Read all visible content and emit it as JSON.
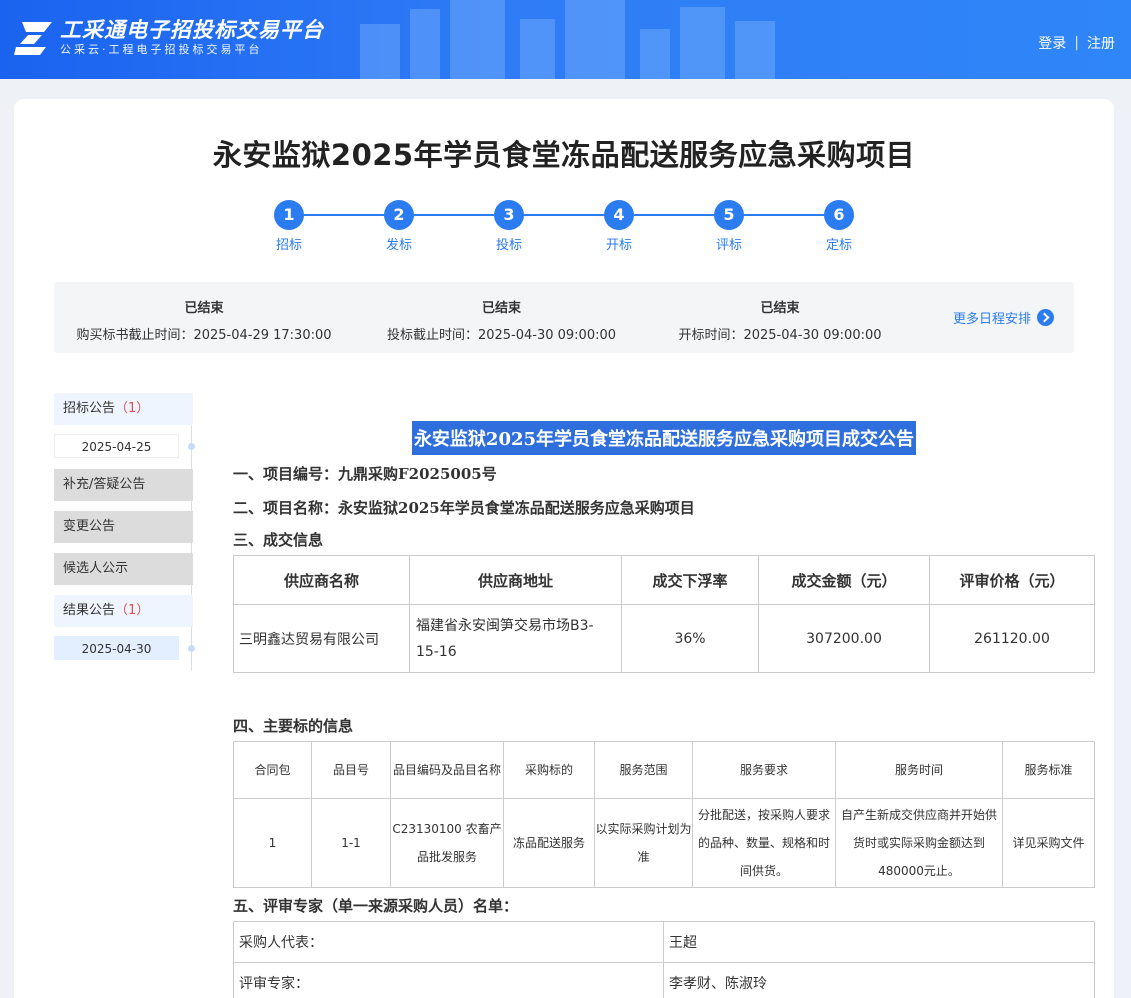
{
  "header": {
    "logo_title": "工采通电子招投标交易平台",
    "logo_sub": "公采云·工程电子招投标交易平台",
    "login": "登录",
    "separator": "|",
    "register": "注册"
  },
  "project": {
    "title": "永安监狱2025年学员食堂冻品配送服务应急采购项目"
  },
  "steps": [
    {
      "num": "1",
      "label": "招标"
    },
    {
      "num": "2",
      "label": "发标"
    },
    {
      "num": "3",
      "label": "投标"
    },
    {
      "num": "4",
      "label": "开标"
    },
    {
      "num": "5",
      "label": "评标"
    },
    {
      "num": "6",
      "label": "定标"
    }
  ],
  "schedule": {
    "items": [
      {
        "status": "已结束",
        "text": "购买标书截止时间：2025-04-29 17:30:00"
      },
      {
        "status": "已结束",
        "text": "投标截止时间：2025-04-30 09:00:00"
      },
      {
        "status": "已结束",
        "text": "开标时间：2025-04-30 09:00:00"
      }
    ],
    "more": "更多日程安排"
  },
  "sidebar": {
    "bid_notice": "招标公告",
    "bid_notice_count": "（1）",
    "bid_notice_date": "2025-04-25",
    "supplement": "补充/答疑公告",
    "change": "变更公告",
    "candidate": "候选人公示",
    "result": "结果公告",
    "result_count": "（1）",
    "result_date": "2025-04-30"
  },
  "doc": {
    "title": "永安监狱2025年学员食堂冻品配送服务应急采购项目成交公告",
    "s1": "一、项目编号：九鼎采购F2025005号",
    "s2": "二、项目名称：永安监狱2025年学员食堂冻品配送服务应急采购项目",
    "s3": "三、成交信息",
    "t1_headers": [
      "供应商名称",
      "供应商地址",
      "成交下浮率",
      "成交金额（元）",
      "评审价格（元）"
    ],
    "t1_row": [
      "三明鑫达贸易有限公司",
      "福建省永安闽笋交易市场B3-15-16",
      "36%",
      "307200.00",
      "261120.00"
    ],
    "s4": "四、主要标的信息",
    "t2_headers": [
      "合同包",
      "品目号",
      "品目编码及品目名称",
      "采购标的",
      "服务范围",
      "服务要求",
      "服务时间",
      "服务标准"
    ],
    "t2_row": [
      "1",
      "1-1",
      "C23130100 农畜产品批发服务",
      "冻品配送服务",
      "以实际采购计划为准",
      "分批配送，按采购人要求的品种、数量、规格和时间供货。",
      "自产生新成交供应商并开始供货时或实际采购金额达到480000元止。",
      "详见采购文件"
    ],
    "s5": "五、评审专家（单一来源采购人员）名单：",
    "t3_rows": [
      [
        "采购人代表：",
        "王超"
      ],
      [
        "评审专家：",
        "李孝财、陈淑玲"
      ]
    ]
  }
}
